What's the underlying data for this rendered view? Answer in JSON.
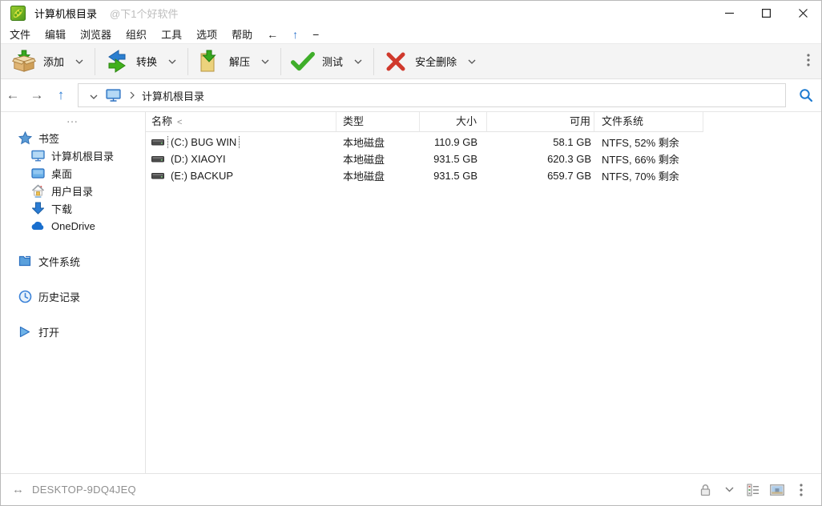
{
  "window": {
    "title": "计算机根目录",
    "watermark": "@下1个好软件"
  },
  "menu": {
    "items": [
      "文件",
      "编辑",
      "浏览器",
      "组织",
      "工具",
      "选项",
      "帮助",
      "←",
      "↑",
      "−"
    ]
  },
  "toolbar": {
    "buttons": [
      {
        "label": "添加",
        "icon": "add-archive-icon"
      },
      {
        "label": "转换",
        "icon": "convert-icon"
      },
      {
        "label": "解压",
        "icon": "extract-icon"
      },
      {
        "label": "测试",
        "icon": "test-icon"
      },
      {
        "label": "安全删除",
        "icon": "secure-delete-icon"
      }
    ]
  },
  "addressbar": {
    "path": "计算机根目录"
  },
  "sidebar": {
    "overflow": "…",
    "bookmarks_label": "书签",
    "bookmarks": [
      {
        "label": "计算机根目录",
        "icon": "computer-icon"
      },
      {
        "label": "桌面",
        "icon": "desktop-icon"
      },
      {
        "label": "用户目录",
        "icon": "home-icon"
      },
      {
        "label": "下载",
        "icon": "download-icon"
      },
      {
        "label": "OneDrive",
        "icon": "onedrive-cloud-icon"
      }
    ],
    "sections": [
      {
        "label": "文件系统",
        "icon": "filesystem-icon"
      },
      {
        "label": "历史记录",
        "icon": "history-clock-icon"
      },
      {
        "label": "打开",
        "icon": "open-play-icon"
      }
    ]
  },
  "filelist": {
    "columns": [
      {
        "label": "名称",
        "sort": "<"
      },
      {
        "label": "类型"
      },
      {
        "label": "大小"
      },
      {
        "label": "可用"
      },
      {
        "label": "文件系统"
      }
    ],
    "rows": [
      {
        "name": "(C:) BUG WIN",
        "type": "本地磁盘",
        "size": "110.9 GB",
        "free": "58.1 GB",
        "filesystem": "NTFS, 52% 剩余"
      },
      {
        "name": "(D:) XIAOYI",
        "type": "本地磁盘",
        "size": "931.5 GB",
        "free": "620.3 GB",
        "filesystem": "NTFS, 66% 剩余"
      },
      {
        "name": "(E:) BACKUP",
        "type": "本地磁盘",
        "size": "931.5 GB",
        "free": "659.7 GB",
        "filesystem": "NTFS, 70% 剩余"
      }
    ]
  },
  "statusbar": {
    "host": "DESKTOP-9DQ4JEQ"
  },
  "colors": {
    "accent_blue": "#2a7cd4",
    "green": "#3fae2a",
    "red": "#d0392c",
    "folder_yellow": "#ecd27c",
    "box_tan": "#e0b574"
  }
}
